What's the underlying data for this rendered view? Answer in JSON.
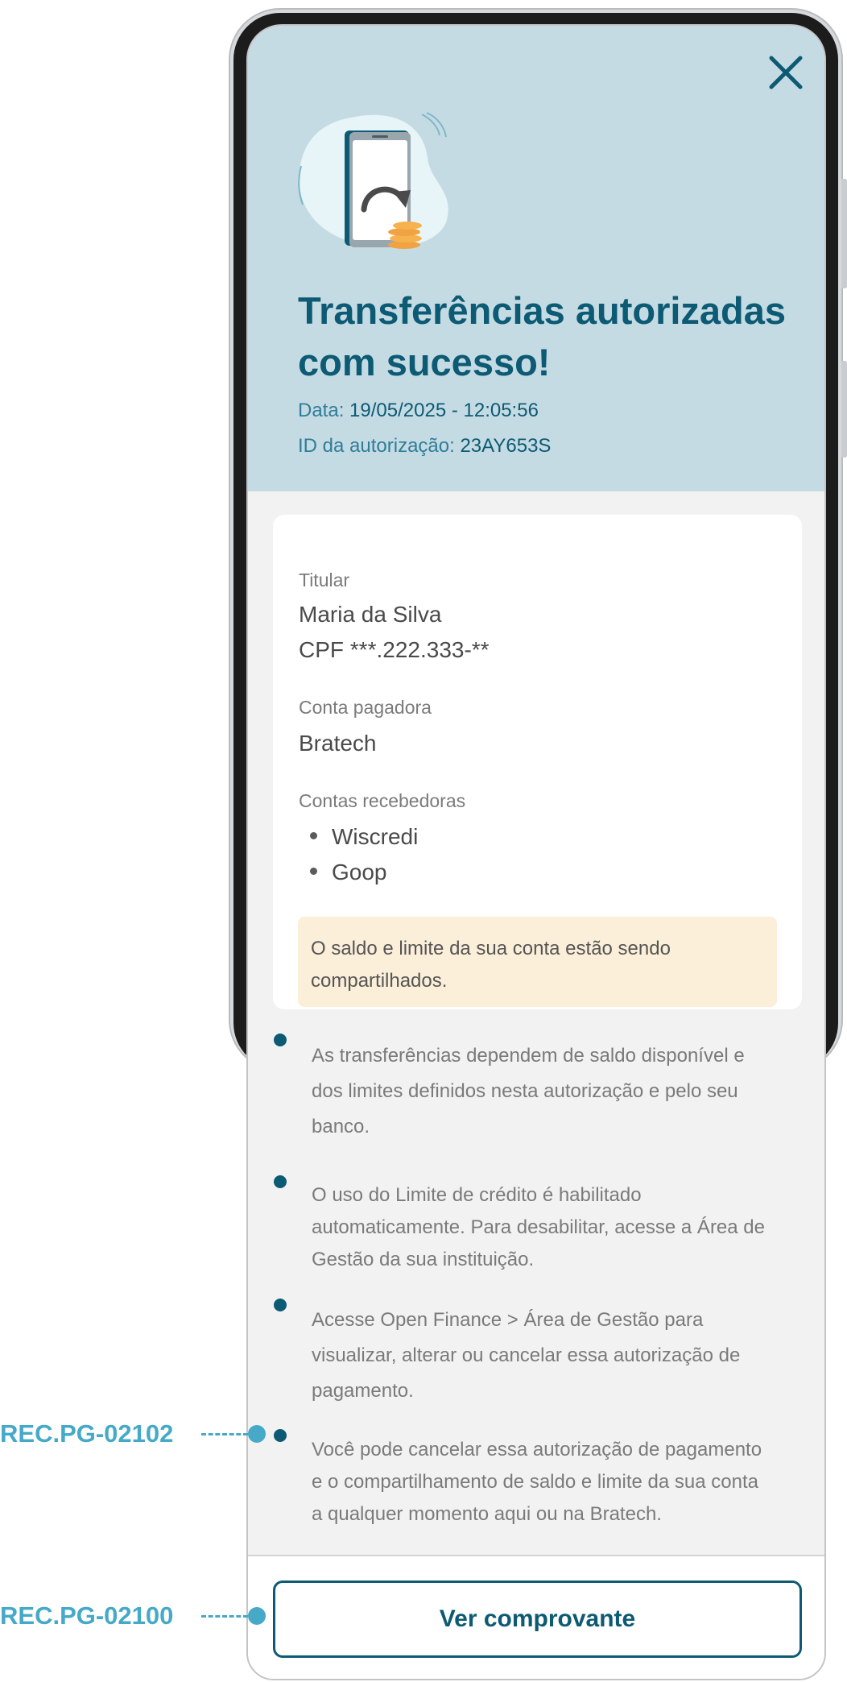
{
  "header": {
    "title": "Transferências autorizadas com sucesso!",
    "date_label": "Data:",
    "date_value": "19/05/2025 - 12:05:56",
    "auth_id_label": "ID da autorização:",
    "auth_id_value": "23AY653S"
  },
  "card": {
    "holder_label": "Titular",
    "holder_name": "Maria da Silva",
    "holder_cpf": "CPF ***.222.333-**",
    "payer_label": "Conta pagadora",
    "payer_value": "Bratech",
    "receivers_label": "Contas recebedoras",
    "receivers": [
      "Wiscredi",
      "Goop"
    ],
    "notice_line1": "O saldo e limite da sua conta estão sendo",
    "notice_line2": "compartilhados."
  },
  "info": [
    {
      "lines": [
        "As transferências dependem de saldo disponível e",
        "dos limites definidos nesta autorização e pelo seu",
        "banco."
      ]
    },
    {
      "lines": [
        "O uso do Limite de crédito é habilitado",
        "automaticamente. Para desabilitar, acesse a Área de",
        "Gestão da sua instituição."
      ]
    },
    {
      "lines": [
        "Acesse Open Finance > Área de Gestão para",
        "visualizar, alterar ou cancelar essa autorização de",
        "pagamento."
      ]
    },
    {
      "lines": [
        "Você pode cancelar essa autorização de pagamento",
        "e o compartilhamento de saldo e limite da sua conta",
        "a qualquer momento aqui ou na Bratech."
      ]
    }
  ],
  "footer": {
    "button_label": "Ver comprovante"
  },
  "annotations": {
    "info_item": "REC.PG-02102",
    "button": "REC.PG-02100"
  },
  "icons": {
    "close": "close-icon",
    "illustration": "phone-transfer-coins-illustration"
  },
  "colors": {
    "primary": "#0c5a73",
    "hero_bg": "#c5dbe3",
    "annotation": "#46a9c8",
    "notice_bg": "#fcefd9"
  }
}
